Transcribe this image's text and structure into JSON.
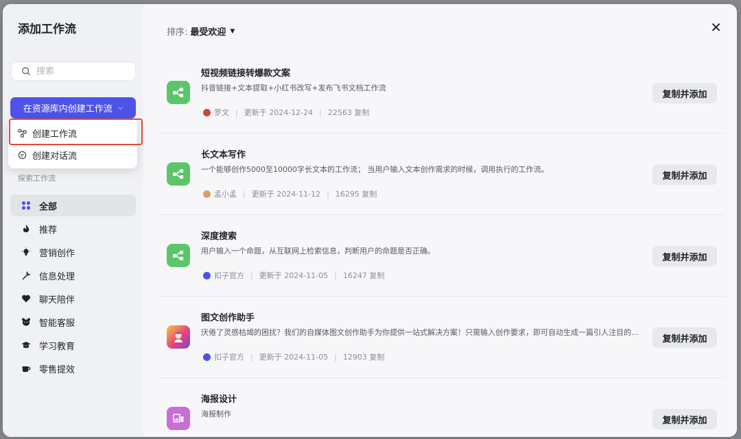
{
  "sidebar": {
    "title": "添加工作流",
    "search_placeholder": "搜索",
    "create_button": "在资源库内创建工作流",
    "dropdown": [
      {
        "label": "创建工作流",
        "icon": "workflow-icon"
      },
      {
        "label": "创建对话流",
        "icon": "chat-flow-icon"
      }
    ],
    "section_label": "探索工作流",
    "categories": [
      {
        "label": "全部",
        "icon": "grid-icon",
        "active": true
      },
      {
        "label": "推荐",
        "icon": "fire-icon"
      },
      {
        "label": "营销创作",
        "icon": "bulb-icon"
      },
      {
        "label": "信息处理",
        "icon": "wrench-icon"
      },
      {
        "label": "聊天陪伴",
        "icon": "heart-icon"
      },
      {
        "label": "智能客服",
        "icon": "bear-icon"
      },
      {
        "label": "学习教育",
        "icon": "graduation-cap-icon"
      },
      {
        "label": "零售提效",
        "icon": "cup-icon"
      }
    ]
  },
  "main": {
    "sort_label": "排序:",
    "sort_value": "最受欢迎",
    "add_button_label": "复制并添加",
    "items": [
      {
        "title": "短视频链接转爆款文案",
        "desc": "抖音链接+文本提取+小红书改写+发布飞书文档工作流",
        "author": "罗文",
        "updated": "更新于 2024-12-24",
        "copies": "22563 复制",
        "icon_color": "#5ac668"
      },
      {
        "title": "长文本写作",
        "desc": "一个能够创作5000至10000字长文本的工作流； 当用户输入文本创作需求的时候，调用执行的工作流。",
        "author": "孟小孟",
        "updated": "更新于 2024-11-12",
        "copies": "16295 复制",
        "icon_color": "#5ac668"
      },
      {
        "title": "深度搜索",
        "desc": "用户输入一个命题，从互联网上检索信息，判断用户的命题是否正确。",
        "author": "扣子官方",
        "updated": "更新于 2024-11-05",
        "copies": "16247 复制",
        "icon_color": "#5ac668"
      },
      {
        "title": "图文创作助手",
        "desc": "厌倦了灵感枯竭的困扰？我们的自媒体图文创作助手为你提供一站式解决方案！只需输入创作要求，即可自动生成一篇引人注目的图文内容",
        "author": "扣子官方",
        "updated": "更新于 2024-11-05",
        "copies": "12903 复制",
        "icon_color": "#e8437b"
      },
      {
        "title": "海报设计",
        "desc": "海报制作",
        "author": "",
        "updated": "",
        "copies": "",
        "icon_color": "#c86ed6"
      }
    ]
  }
}
